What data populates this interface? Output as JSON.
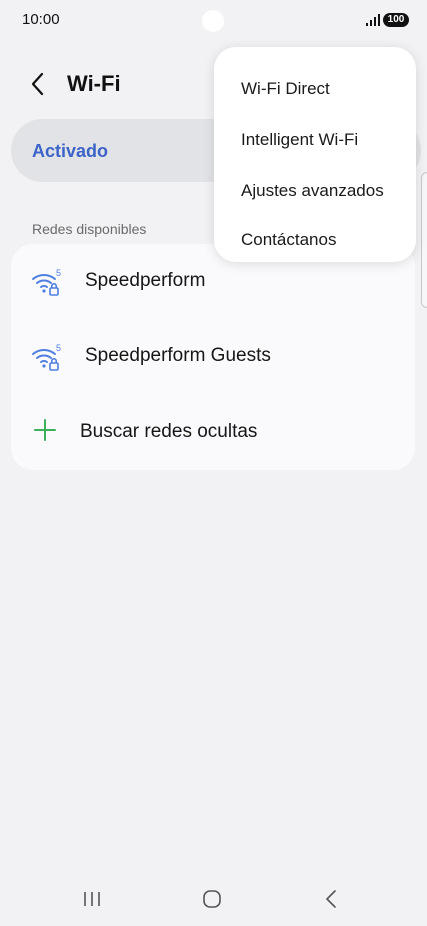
{
  "status_bar": {
    "time": "10:00",
    "battery": "100"
  },
  "header": {
    "title": "Wi-Fi"
  },
  "wifi_toggle": {
    "label": "Activado"
  },
  "networks": {
    "section_label": "Redes disponibles",
    "items": [
      {
        "name": "Speedperform",
        "icon": "wifi-5ghz-locked-icon"
      },
      {
        "name": "Speedperform Guests",
        "icon": "wifi-5ghz-locked-icon"
      }
    ],
    "add_hidden_label": "Buscar redes ocultas"
  },
  "menu": {
    "items": [
      {
        "label": "Wi-Fi Direct"
      },
      {
        "label": "Intelligent Wi-Fi"
      },
      {
        "label": "Ajustes avanzados"
      },
      {
        "label": "Contáctanos"
      }
    ]
  },
  "colors": {
    "accent": "#3c64c8",
    "wifi_icon": "#4f7fe0",
    "plus_icon": "#3dae5a",
    "background": "#f2f2f4"
  }
}
